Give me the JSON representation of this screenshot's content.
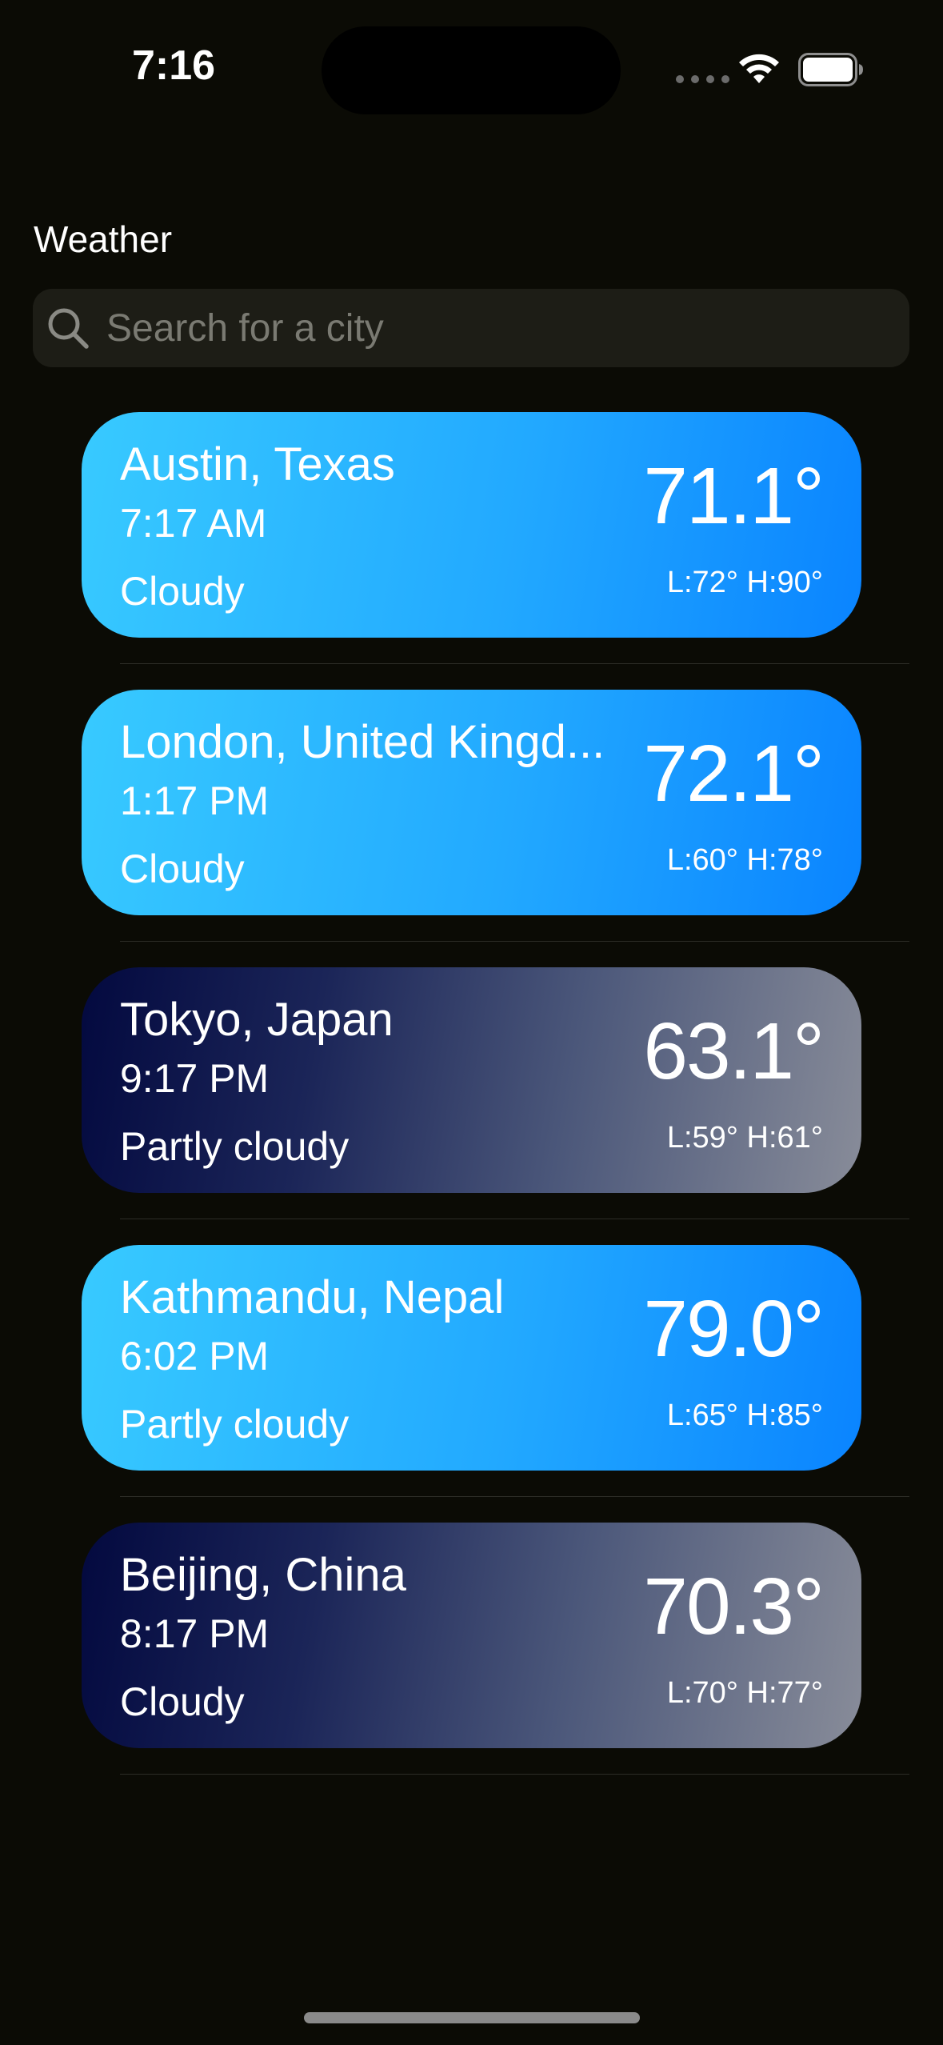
{
  "status_bar": {
    "time": "7:16"
  },
  "header": {
    "title": "Weather"
  },
  "search": {
    "placeholder": "Search for a city",
    "value": ""
  },
  "cities": [
    {
      "name": "Austin, Texas",
      "local_time": "7:17 AM",
      "condition": "Cloudy",
      "temperature": "71.1°",
      "range": "L:72° H:90°",
      "theme": "sunny"
    },
    {
      "name": "London, United Kingd...",
      "local_time": "1:17 PM",
      "condition": "Cloudy",
      "temperature": "72.1°",
      "range": "L:60° H:78°",
      "theme": "sunny"
    },
    {
      "name": "Tokyo, Japan",
      "local_time": "9:17 PM",
      "condition": "Partly cloudy",
      "temperature": "63.1°",
      "range": "L:59° H:61°",
      "theme": "night"
    },
    {
      "name": "Kathmandu, Nepal",
      "local_time": "6:02 PM",
      "condition": "Partly cloudy",
      "temperature": "79.0°",
      "range": "L:65° H:85°",
      "theme": "sunny"
    },
    {
      "name": "Beijing, China",
      "local_time": "8:17 PM",
      "condition": "Cloudy",
      "temperature": "70.3°",
      "range": "L:70° H:77°",
      "theme": "night"
    }
  ],
  "colors": {
    "background": "#0b0b05",
    "search_bg": "#1d1d16",
    "day_card_start": "#38caff",
    "day_card_end": "#0a84ff",
    "night_card_start": "#03093f",
    "night_card_end": "#888c99"
  },
  "icons": {
    "search": "magnifying-glass",
    "wifi": "wifi",
    "battery": "battery-full"
  }
}
